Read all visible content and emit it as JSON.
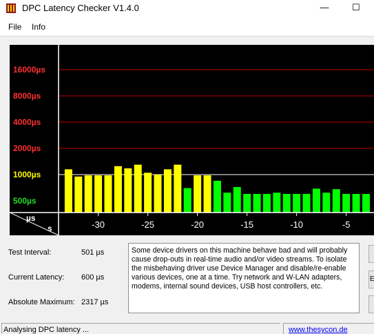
{
  "window": {
    "title": "DPC Latency Checker V1.4.0",
    "minimize_glyph": "—",
    "maximize_glyph": "☐"
  },
  "menu": [
    "File",
    "Info"
  ],
  "chart_data": {
    "type": "bar",
    "background": "#000000",
    "gridline_color": "#c00000",
    "y_scale": "log",
    "y_tick_labels": [
      {
        "label": "16000µs",
        "value": 16000,
        "color": "#ff3030"
      },
      {
        "label": "8000µs",
        "value": 8000,
        "color": "#ff3030"
      },
      {
        "label": "4000µs",
        "value": 4000,
        "color": "#ff3030"
      },
      {
        "label": "2000µs",
        "value": 2000,
        "color": "#ff3030"
      },
      {
        "label": "1000µs",
        "value": 1000,
        "color": "#ffff00"
      },
      {
        "label": "500µs",
        "value": 500,
        "color": "#22dd22"
      }
    ],
    "x_tick_labels": [
      "-30",
      "-25",
      "-20",
      "-15",
      "-10",
      "-5"
    ],
    "x_ticks": [
      -30,
      -25,
      -20,
      -15,
      -10,
      -5
    ],
    "x_range": [
      -34,
      -2.2
    ],
    "y_unit": "µs",
    "x_unit": "s",
    "bar_colors": {
      "yellow": "#ffff00",
      "green": "#00ff00"
    },
    "bars": [
      {
        "x": -33,
        "value": 1150,
        "color": "yellow"
      },
      {
        "x": -32,
        "value": 950,
        "color": "yellow"
      },
      {
        "x": -31,
        "value": 980,
        "color": "yellow"
      },
      {
        "x": -30,
        "value": 980,
        "color": "yellow"
      },
      {
        "x": -29,
        "value": 980,
        "color": "yellow"
      },
      {
        "x": -28,
        "value": 1250,
        "color": "yellow"
      },
      {
        "x": -27,
        "value": 1180,
        "color": "yellow"
      },
      {
        "x": -26,
        "value": 1300,
        "color": "yellow"
      },
      {
        "x": -25,
        "value": 1050,
        "color": "yellow"
      },
      {
        "x": -24,
        "value": 1000,
        "color": "yellow"
      },
      {
        "x": -23,
        "value": 1150,
        "color": "yellow"
      },
      {
        "x": -22,
        "value": 1300,
        "color": "yellow"
      },
      {
        "x": -21,
        "value": 700,
        "color": "green"
      },
      {
        "x": -20,
        "value": 980,
        "color": "yellow"
      },
      {
        "x": -19,
        "value": 980,
        "color": "yellow"
      },
      {
        "x": -18,
        "value": 850,
        "color": "green"
      },
      {
        "x": -17,
        "value": 620,
        "color": "green"
      },
      {
        "x": -16,
        "value": 720,
        "color": "green"
      },
      {
        "x": -15,
        "value": 600,
        "color": "green"
      },
      {
        "x": -14,
        "value": 600,
        "color": "green"
      },
      {
        "x": -13,
        "value": 600,
        "color": "green"
      },
      {
        "x": -12,
        "value": 620,
        "color": "green"
      },
      {
        "x": -11,
        "value": 600,
        "color": "green"
      },
      {
        "x": -10,
        "value": 600,
        "color": "green"
      },
      {
        "x": -9,
        "value": 600,
        "color": "green"
      },
      {
        "x": -8,
        "value": 690,
        "color": "green"
      },
      {
        "x": -7,
        "value": 620,
        "color": "green"
      },
      {
        "x": -6,
        "value": 680,
        "color": "green"
      },
      {
        "x": -5,
        "value": 600,
        "color": "green"
      },
      {
        "x": -4,
        "value": 600,
        "color": "green"
      },
      {
        "x": -3,
        "value": 600,
        "color": "green"
      }
    ]
  },
  "info": {
    "test_interval_label": "Test Interval:",
    "test_interval_value": "501 µs",
    "current_latency_label": "Current Latency:",
    "current_latency_value": "600 µs",
    "absolute_maximum_label": "Absolute Maximum:",
    "absolute_maximum_value": "2317 µs"
  },
  "description": "Some device drivers on this machine behave bad and will probably cause drop-outs in real-time audio and/or video streams. To isolate the misbehaving driver use Device Manager and disable/re-enable various devices, one at a time. Try network and W-LAN adapters, modems, internal sound devices, USB host controllers, etc.",
  "side_buttons": [
    "",
    "E",
    ""
  ],
  "status": {
    "text": "Analysing DPC latency ...",
    "link": "www.thesycon.de"
  }
}
